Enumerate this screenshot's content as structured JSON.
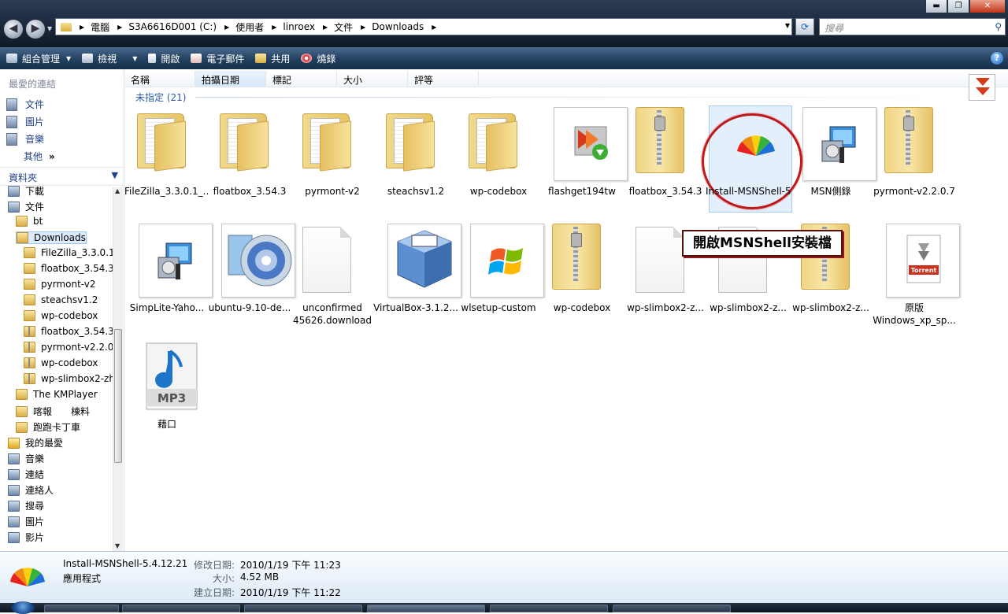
{
  "window": {
    "min_label": "▬",
    "max_label": "❐",
    "close_label": "✕"
  },
  "nav": {
    "back": "◀",
    "forward": "▶"
  },
  "address": {
    "crumbs": [
      "電腦",
      "S3A6616D001 (C:)",
      "使用者",
      "linroex",
      "文件",
      "Downloads"
    ],
    "separator": "▶"
  },
  "search": {
    "placeholder": "搜尋"
  },
  "toolbar": {
    "organize": "組合管理",
    "views": "檢視",
    "open": "開啟",
    "email": "電子郵件",
    "share": "共用",
    "burn": "燒錄"
  },
  "sidebar": {
    "favorites_title": "最愛的連結",
    "favorites": [
      "文件",
      "圖片",
      "音樂"
    ],
    "more": "其他",
    "more_chevron": "»",
    "folders_title": "資料夾",
    "tree": [
      {
        "label": "下載",
        "indent": 0,
        "icon": "lib"
      },
      {
        "label": "文件",
        "indent": 0,
        "icon": "lib"
      },
      {
        "label": "bt",
        "indent": 1,
        "icon": "fold"
      },
      {
        "label": "Downloads",
        "indent": 1,
        "icon": "fold",
        "selected": true
      },
      {
        "label": "FileZilla_3.3.0.1_",
        "indent": 2,
        "icon": "fold"
      },
      {
        "label": "floatbox_3.54.3",
        "indent": 2,
        "icon": "fold"
      },
      {
        "label": "pyrmont-v2",
        "indent": 2,
        "icon": "fold"
      },
      {
        "label": "steachsv1.2",
        "indent": 2,
        "icon": "fold"
      },
      {
        "label": "wp-codebox",
        "indent": 2,
        "icon": "fold"
      },
      {
        "label": "floatbox_3.54.3",
        "indent": 2,
        "icon": "zip"
      },
      {
        "label": "pyrmont-v2.2.0",
        "indent": 2,
        "icon": "zip"
      },
      {
        "label": "wp-codebox",
        "indent": 2,
        "icon": "zip"
      },
      {
        "label": "wp-slimbox2-zh",
        "indent": 2,
        "icon": "zip"
      },
      {
        "label": "The KMPlayer",
        "indent": 1,
        "icon": "fold"
      },
      {
        "label": "喀報　　棟料",
        "indent": 1,
        "icon": "fold"
      },
      {
        "label": "跑跑卡丁車",
        "indent": 1,
        "icon": "fold"
      },
      {
        "label": "我的最愛",
        "indent": 0,
        "icon": "star"
      },
      {
        "label": "音樂",
        "indent": 0,
        "icon": "lib"
      },
      {
        "label": "連結",
        "indent": 0,
        "icon": "lib"
      },
      {
        "label": "連絡人",
        "indent": 0,
        "icon": "lib"
      },
      {
        "label": "搜尋",
        "indent": 0,
        "icon": "lib"
      },
      {
        "label": "圖片",
        "indent": 0,
        "icon": "lib"
      },
      {
        "label": "影片",
        "indent": 0,
        "icon": "lib"
      }
    ]
  },
  "columns": [
    "名稱",
    "拍攝日期",
    "標記",
    "大小",
    "評等"
  ],
  "group_label": "未指定 (21)",
  "files": [
    {
      "name": "FileZilla_3.3.0.1_...",
      "kind": "folder"
    },
    {
      "name": "floatbox_3.54.3",
      "kind": "folder"
    },
    {
      "name": "pyrmont-v2",
      "kind": "folder"
    },
    {
      "name": "steachsv1.2",
      "kind": "folder"
    },
    {
      "name": "wp-codebox",
      "kind": "folder"
    },
    {
      "name": "flashget194tw",
      "kind": "flashget"
    },
    {
      "name": "floatbox_3.54.3",
      "kind": "zip"
    },
    {
      "name": "Install-MSNShell-5.4.12.21",
      "kind": "msnshell",
      "selected": true
    },
    {
      "name": "MSN側錄",
      "kind": "installer"
    },
    {
      "name": "pyrmont-v2.2.0.7",
      "kind": "zip"
    },
    {
      "name": "SimpLite-Yaho...",
      "kind": "installer"
    },
    {
      "name": "ubuntu-9.10-de...",
      "kind": "disc"
    },
    {
      "name": "unconfirmed 45626.download",
      "kind": "page"
    },
    {
      "name": "VirtualBox-3.1.2...",
      "kind": "vbox"
    },
    {
      "name": "wlsetup-custom",
      "kind": "windows"
    },
    {
      "name": "wp-codebox",
      "kind": "zip"
    },
    {
      "name": "wp-slimbox2-z...",
      "kind": "page"
    },
    {
      "name": "wp-slimbox2-z...",
      "kind": "page"
    },
    {
      "name": "wp-slimbox2-z...",
      "kind": "zip"
    },
    {
      "name": "原版 Windows_xp_sp...",
      "kind": "torrent"
    },
    {
      "name": "藉口",
      "kind": "mp3"
    }
  ],
  "callout": "開啟MSNShell安裝檔",
  "badges": {
    "torrent": "Torrent",
    "mp3": "MP3"
  },
  "details": {
    "name": "Install-MSNShell-5.4.12.21",
    "type": "應用程式",
    "modified_label": "修改日期:",
    "modified": "2010/1/19 下午 11:23",
    "size_label": "大小:",
    "size": "4.52 MB",
    "created_label": "建立日期:",
    "created": "2010/1/19 下午 11:22"
  },
  "colors": {
    "accent": "#1f3f8a",
    "ring": "#c0191b"
  }
}
